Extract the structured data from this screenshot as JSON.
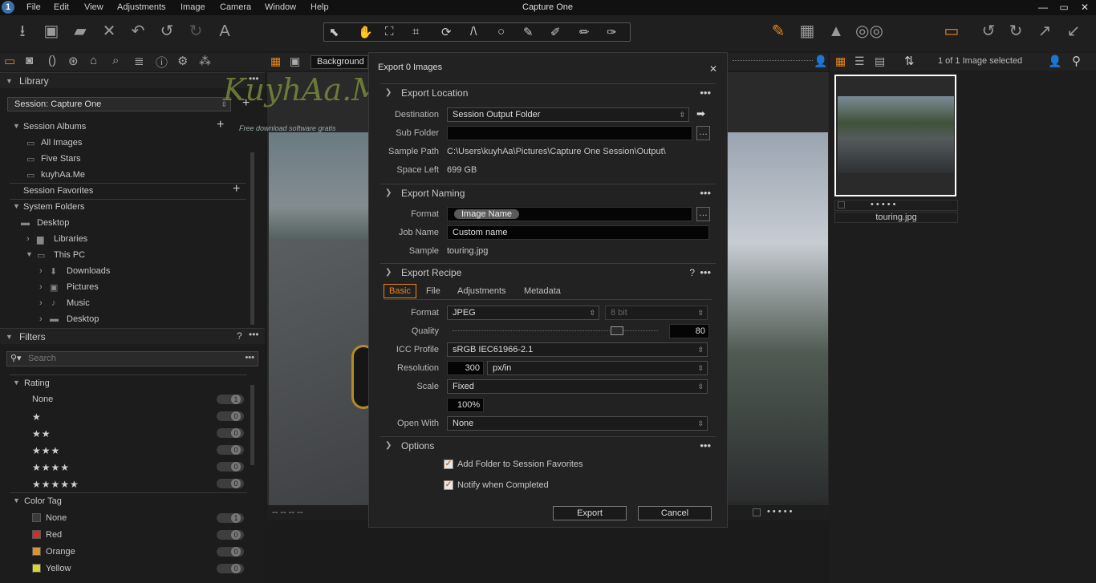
{
  "app": {
    "title": "Capture One",
    "logo": "1"
  },
  "menu": [
    "File",
    "Edit",
    "View",
    "Adjustments",
    "Image",
    "Camera",
    "Window",
    "Help"
  ],
  "window_controls": {
    "minimize": "—",
    "maximize": "▭",
    "close": "✕"
  },
  "left": {
    "library": {
      "title": "Library",
      "session_select": "Session: Capture One",
      "session_albums": "Session Albums",
      "albums": [
        "All Images",
        "Five Stars",
        "kuyhAa.Me"
      ],
      "session_favorites": "Session Favorites",
      "system_folders": "System Folders",
      "folders": [
        {
          "label": "Desktop"
        },
        {
          "label": "Libraries"
        },
        {
          "label": "This PC"
        },
        {
          "label": "Downloads"
        },
        {
          "label": "Pictures"
        },
        {
          "label": "Music"
        },
        {
          "label": "Desktop"
        }
      ]
    },
    "filters": {
      "title": "Filters",
      "help": "?",
      "search_placeholder": "Search",
      "rating_title": "Rating",
      "ratings": [
        {
          "label": "None",
          "count": "1"
        },
        {
          "stars": "★",
          "count": "0"
        },
        {
          "stars": "★★",
          "count": "0"
        },
        {
          "stars": "★★★",
          "count": "0"
        },
        {
          "stars": "★★★★",
          "count": "0"
        },
        {
          "stars": "★★★★★",
          "count": "0"
        }
      ],
      "color_tag_title": "Color Tag",
      "color_tags": [
        {
          "label": "None",
          "count": "1",
          "color": "#3a3a3a"
        },
        {
          "label": "Red",
          "count": "0",
          "color": "#d62b2b"
        },
        {
          "label": "Orange",
          "count": "0",
          "color": "#d9942b"
        },
        {
          "label": "Yellow",
          "count": "0",
          "color": "#d8d82b"
        }
      ]
    }
  },
  "viewer": {
    "background_label": "Background",
    "footer_left": "-- -- -- --",
    "footer_dots": "• • • • •"
  },
  "right": {
    "selection_label": "1 of 1 Image selected",
    "filename": "touring.jpg",
    "thumb_dots": "• • • • •"
  },
  "watermark": {
    "text": "KuyhAa.Me",
    "subtext": "Free download software gratis"
  },
  "dialog": {
    "title": "Export 0 Images",
    "close": "✕",
    "export_location": {
      "title": "Export Location",
      "destination_label": "Destination",
      "destination_value": "Session Output Folder",
      "subfolder_label": "Sub Folder",
      "subfolder_value": "",
      "sample_path_label": "Sample Path",
      "sample_path_value": "C:\\Users\\kuyhAa\\Pictures\\Capture One Session\\Output\\",
      "space_left_label": "Space Left",
      "space_left_value": "699 GB"
    },
    "export_naming": {
      "title": "Export Naming",
      "format_label": "Format",
      "format_token": "Image Name",
      "job_name_label": "Job Name",
      "job_name_value": "Custom name",
      "sample_label": "Sample",
      "sample_value": "touring.jpg"
    },
    "export_recipe": {
      "title": "Export Recipe",
      "help": "?",
      "tabs": [
        "Basic",
        "File",
        "Adjustments",
        "Metadata"
      ],
      "format_label": "Format",
      "format_value": "JPEG",
      "bit_value": "8 bit",
      "quality_label": "Quality",
      "quality_value": "80",
      "quality_level": 0.8,
      "icc_label": "ICC Profile",
      "icc_value": "sRGB IEC61966-2.1",
      "resolution_label": "Resolution",
      "resolution_value": "300",
      "resolution_unit": "px/in",
      "scale_label": "Scale",
      "scale_value": "Fixed",
      "scale_percent": "100%",
      "open_with_label": "Open With",
      "open_with_value": "None"
    },
    "options": {
      "title": "Options",
      "add_folder": "Add Folder to Session Favorites",
      "notify": "Notify when Completed"
    },
    "export_button": "Export",
    "cancel_button": "Cancel",
    "more": "•••"
  }
}
